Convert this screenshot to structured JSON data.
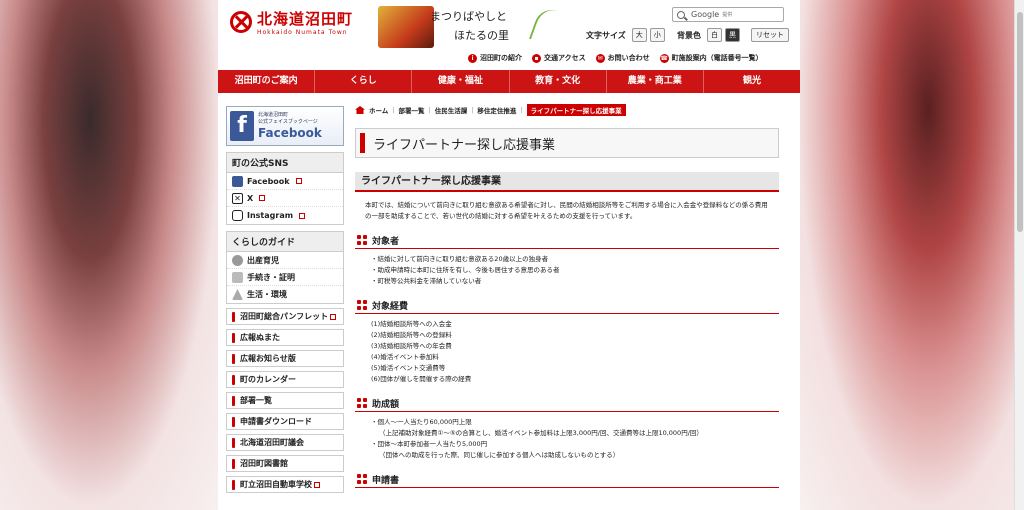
{
  "header": {
    "logo_jp": "北海道沼田町",
    "logo_en": "Hokkaido Numata Town",
    "catch_line1": "まつりばやしと",
    "catch_line2": "ほたるの里",
    "search_brand": "Google",
    "search_suffix": "提供",
    "font_size_label": "文字サイズ",
    "font_large": "大",
    "font_small": "小",
    "bg_color_label": "背景色",
    "bg_white": "白",
    "bg_black": "黒",
    "reset_label": "リセット",
    "utility": [
      "沼田町の紹介",
      "交通アクセス",
      "お問い合わせ",
      "町施設案内（電話番号一覧）"
    ]
  },
  "gnav": [
    "沼田町のご案内",
    "くらし",
    "健康・福祉",
    "教育・文化",
    "農業・商工業",
    "観光"
  ],
  "sidebar": {
    "fb_small1": "北海道沼田町",
    "fb_small2": "公式フェイスブックページ",
    "fb_big": "Facebook",
    "sns_title": "町の公式SNS",
    "sns": [
      "Facebook",
      "X",
      "Instagram"
    ],
    "guide_title": "くらしのガイド",
    "guide": [
      "出産育児",
      "手続き・証明",
      "生活・環境"
    ],
    "links": [
      "沼田町総合パンフレット",
      "広報ぬまた",
      "広報お知らせ版",
      "町のカレンダー",
      "部署一覧",
      "申請書ダウンロード",
      "北海道沼田町議会",
      "沼田町図書館",
      "町立沼田自動車学校"
    ]
  },
  "breadcrumb": [
    "ホーム",
    "部署一覧",
    "住民生活課",
    "移住定住推進",
    "ライフパートナー探し応援事業"
  ],
  "page_title": "ライフパートナー探し応援事業",
  "section_title": "ライフパートナー探し応援事業",
  "lead": "本町では、結婚について前向きに取り組む意欲ある希望者に対し、民間の結婚相談所等をご利用する場合に入会金や登録料などの係る費用の一部を助成することで、若い世代の結婚に対する希望を叶えるための支援を行っています。",
  "sections": {
    "target_title": "対象者",
    "target_items": [
      "・結婚に対して前向きに取り組む意欲ある20歳以上の独身者",
      "・助成申請時に本町に住所を有し、今後も居住する意思のある者",
      "・町税等公共料金を滞納していない者"
    ],
    "cost_title": "対象経費",
    "cost_items": [
      "(1)結婚相談所等への入会金",
      "(2)結婚相談所等への登録料",
      "(3)結婚相談所等への年会費",
      "(4)婚活イベント参加料",
      "(5)婚活イベント交通費等",
      "(6)団体が催しを開催する際の経費"
    ],
    "amount_title": "助成額",
    "amount_items": [
      "・個人〜一人当たり60,000円上限",
      "（上記補助対象経費①〜⑤の合算とし、婚活イベント参加料は上限3,000円/回、交通費等は上限10,000円/回）",
      "・団体〜本町参加者一人当たり5,000円",
      "（団体への助成を行った際、同じ催しに参加する個人へは助成しないものとする）"
    ],
    "apply_title": "申請書"
  },
  "colors": {
    "accent": "#cc1414",
    "fb": "#3b5998"
  }
}
